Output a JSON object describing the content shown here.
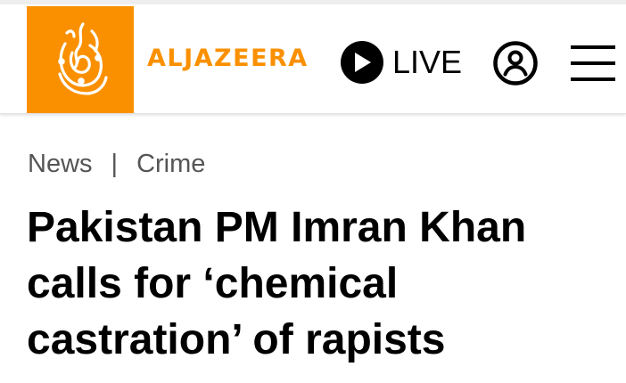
{
  "header": {
    "brand_name": "ALJAZEERA",
    "logo_icon": "aljazeera-calligraphy-logo",
    "live_label": "LIVE",
    "live_icon": "play-icon",
    "account_icon": "user-account-icon",
    "menu_icon": "hamburger-menu-icon",
    "brand_color": "#fa9000"
  },
  "breadcrumb": {
    "items": [
      "News",
      "Crime"
    ],
    "separator": "|"
  },
  "article": {
    "headline": "Pakistan PM Imran Khan calls for ‘chemical castration’ of rapists"
  }
}
